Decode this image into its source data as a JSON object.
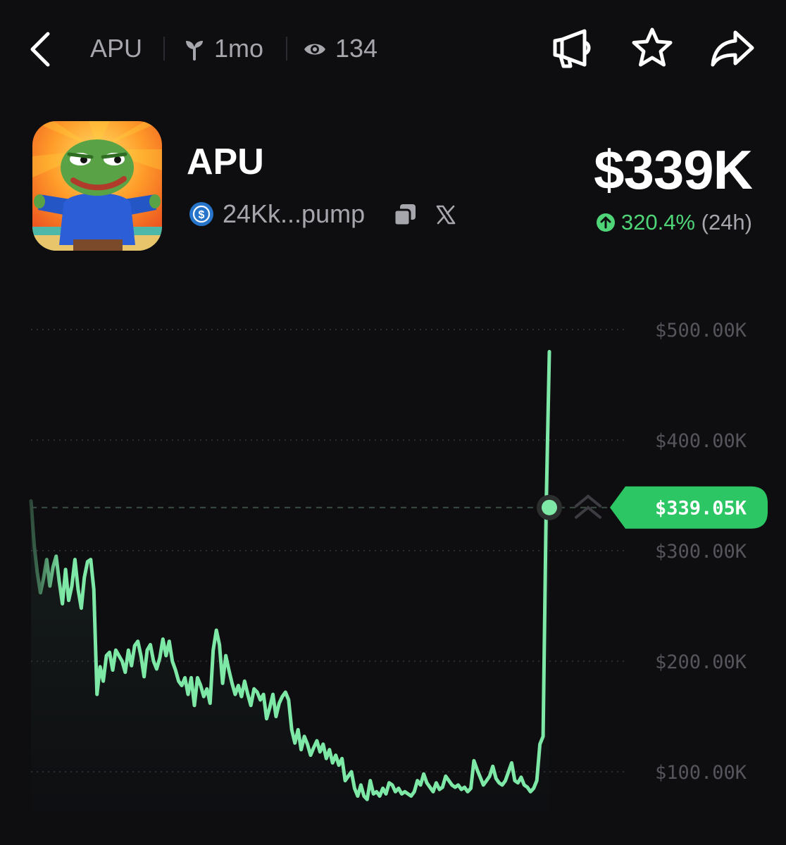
{
  "header": {
    "crumb_symbol": "APU",
    "age": "1mo",
    "views": "134"
  },
  "token": {
    "name": "APU",
    "address_short": "24Kk...pump",
    "market_cap": "$339K",
    "change_pct": "320.4%",
    "change_period": "(24h)"
  },
  "colors": {
    "background": "#0e0e11",
    "accent_green": "#4fd477",
    "line_green": "#7ee8a6",
    "muted_text": "#a6a6ad",
    "axis_text": "#55555c"
  },
  "icons": [
    "back-arrow-icon",
    "sprout-icon",
    "eye-icon",
    "megaphone-icon",
    "star-icon",
    "share-icon",
    "usdc-icon",
    "copy-icon",
    "x-logo-icon",
    "arrow-up-circle-icon",
    "collapse-chevrons-icon"
  ],
  "chart_data": {
    "type": "line",
    "ylim": [
      0,
      540000
    ],
    "y_ticks": [
      {
        "value": 500000,
        "label": "$500.00K"
      },
      {
        "value": 400000,
        "label": "$400.00K"
      },
      {
        "value": 300000,
        "label": "$300.00K"
      },
      {
        "value": 200000,
        "label": "$200.00K"
      },
      {
        "value": 100000,
        "label": "$100.00K"
      }
    ],
    "current": {
      "value": 339050,
      "label": "$339.05K"
    },
    "grid": true,
    "values": [
      345000,
      305000,
      280000,
      262000,
      275000,
      292000,
      268000,
      285000,
      295000,
      272000,
      252000,
      283000,
      255000,
      268000,
      292000,
      265000,
      248000,
      276000,
      290000,
      292000,
      265000,
      170000,
      195000,
      182000,
      205000,
      208000,
      192000,
      210000,
      205000,
      200000,
      190000,
      210000,
      196000,
      214000,
      218000,
      205000,
      186000,
      210000,
      215000,
      200000,
      193000,
      203000,
      220000,
      205000,
      218000,
      200000,
      192000,
      182000,
      178000,
      185000,
      170000,
      185000,
      160000,
      185000,
      178000,
      168000,
      175000,
      162000,
      210000,
      228000,
      215000,
      180000,
      205000,
      192000,
      180000,
      170000,
      178000,
      168000,
      182000,
      170000,
      160000,
      175000,
      172000,
      165000,
      170000,
      148000,
      158000,
      170000,
      150000,
      162000,
      168000,
      172000,
      165000,
      138000,
      126000,
      138000,
      120000,
      132000,
      125000,
      115000,
      122000,
      128000,
      118000,
      125000,
      112000,
      120000,
      108000,
      115000,
      106000,
      112000,
      92000,
      96000,
      100000,
      85000,
      78000,
      88000,
      78000,
      75000,
      92000,
      80000,
      82000,
      78000,
      85000,
      80000,
      90000,
      88000,
      82000,
      85000,
      80000,
      82000,
      80000,
      78000,
      82000,
      92000,
      88000,
      98000,
      90000,
      86000,
      82000,
      90000,
      84000,
      86000,
      96000,
      92000,
      88000,
      86000,
      88000,
      84000,
      86000,
      82000,
      85000,
      110000,
      102000,
      95000,
      88000,
      92000,
      96000,
      105000,
      94000,
      90000,
      88000,
      92000,
      100000,
      108000,
      92000,
      90000,
      95000,
      88000,
      86000,
      82000,
      85000,
      92000,
      125000,
      132000,
      340000,
      480000
    ]
  }
}
